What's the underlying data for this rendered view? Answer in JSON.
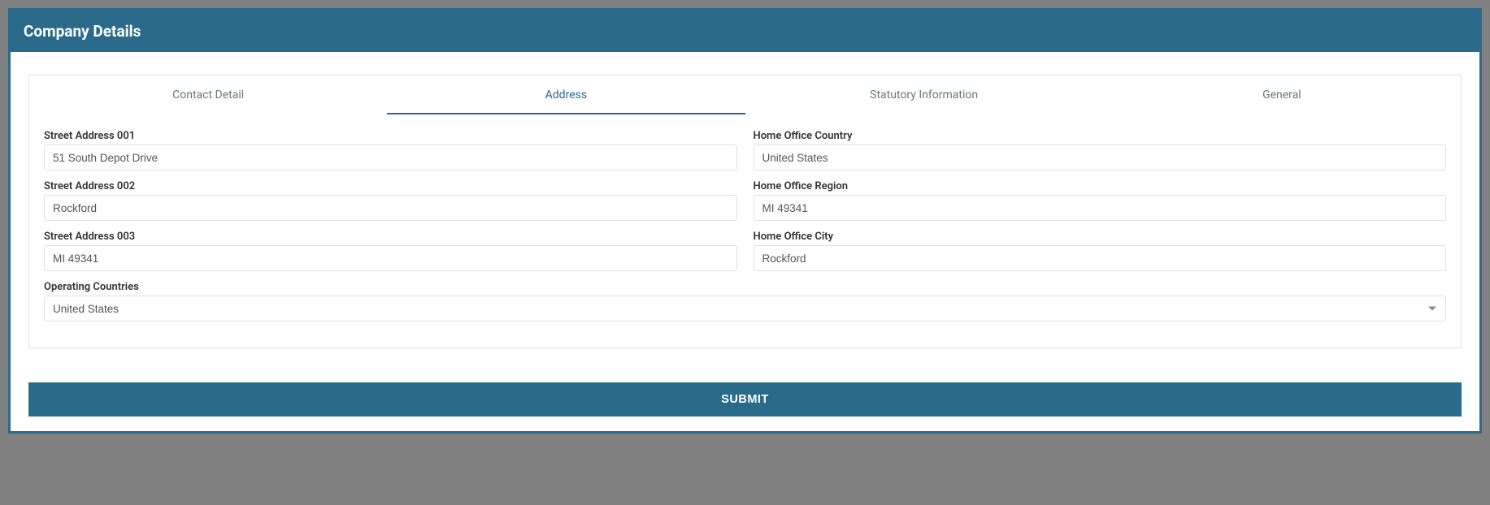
{
  "header": {
    "title": "Company Details"
  },
  "tabs": {
    "contact": "Contact Detail",
    "address": "Address",
    "statutory": "Statutory Information",
    "general": "General"
  },
  "form": {
    "street1": {
      "label": "Street Address 001",
      "value": "51 South Depot Drive"
    },
    "street2": {
      "label": "Street Address 002",
      "value": "Rockford"
    },
    "street3": {
      "label": "Street Address 003",
      "value": "MI 49341"
    },
    "homeCountry": {
      "label": "Home Office Country",
      "value": "United States"
    },
    "homeRegion": {
      "label": "Home Office Region",
      "value": "MI 49341"
    },
    "homeCity": {
      "label": "Home Office City",
      "value": "Rockford"
    },
    "operatingCountries": {
      "label": "Operating Countries",
      "value": "United States"
    }
  },
  "actions": {
    "submit": "Submit"
  }
}
